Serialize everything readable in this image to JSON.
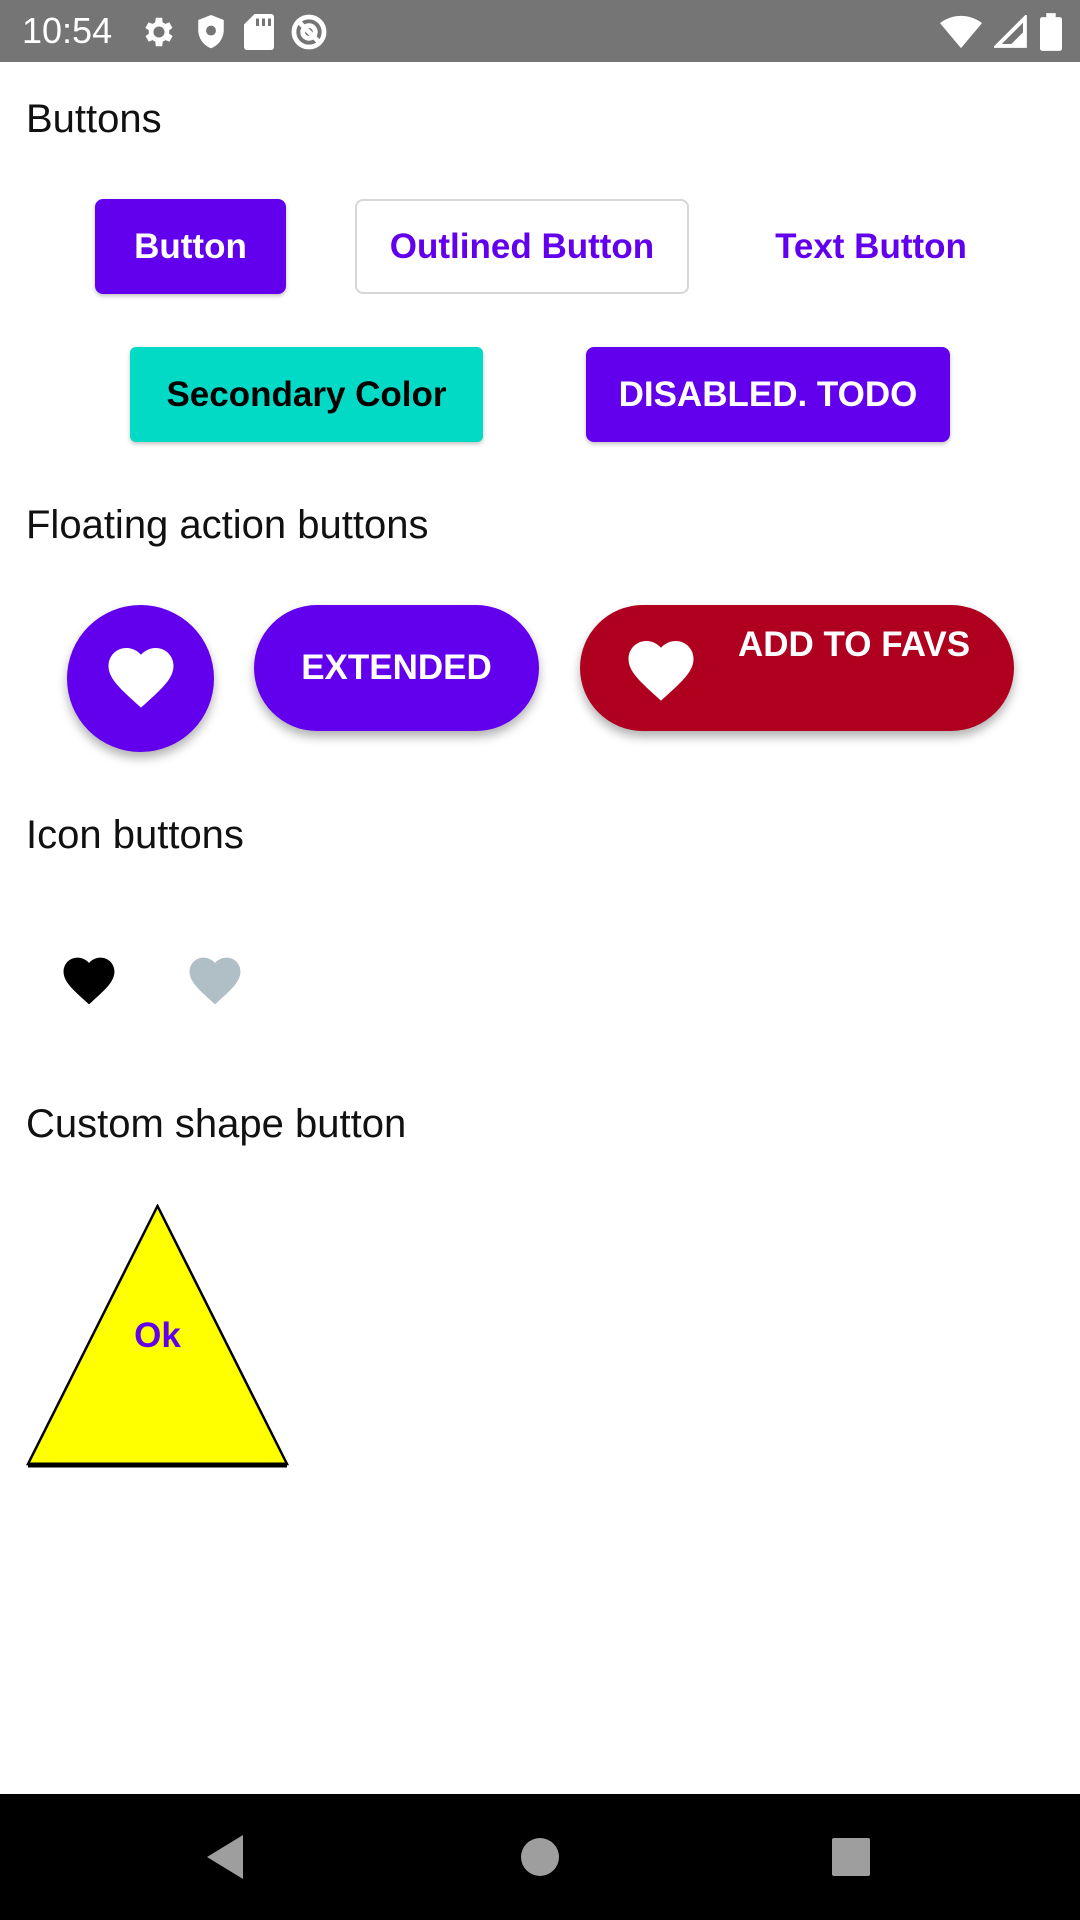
{
  "status_bar": {
    "time": "10:54",
    "left_icons": [
      "gear-icon",
      "shield-icon",
      "sd-card-icon",
      "at-sign-icon"
    ],
    "right_icons": [
      "wifi-icon",
      "cell-signal-icon",
      "battery-icon"
    ]
  },
  "sections": {
    "buttons": "Buttons",
    "fabs": "Floating action buttons",
    "icon_buttons": "Icon buttons",
    "custom_shape": "Custom shape button"
  },
  "buttons": {
    "contained": "Button",
    "outlined": "Outlined Button",
    "text": "Text Button",
    "secondary": "Secondary Color",
    "disabled": "DISABLED. TODO"
  },
  "fabs": {
    "extended": "EXTENDED",
    "add_to_favs": "ADD TO FAVS"
  },
  "custom_shape": {
    "label": "Ok"
  },
  "colors": {
    "primary": "#6200ee",
    "secondary": "#03dac5",
    "error_red": "#b00020",
    "disabled_icon": "#b0bec5",
    "triangle_fill": "#ffff00"
  }
}
